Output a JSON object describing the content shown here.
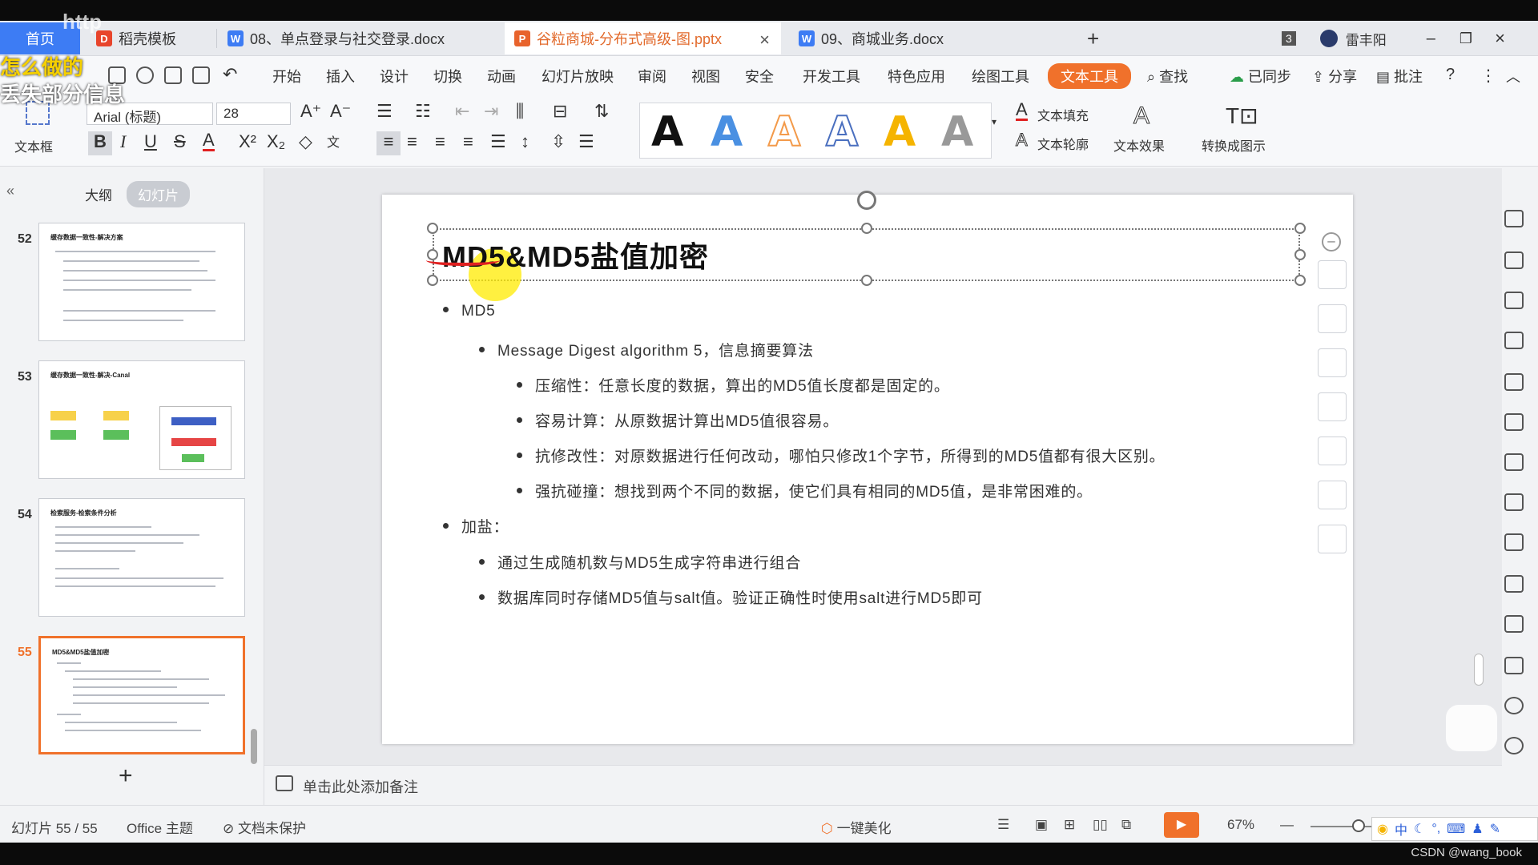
{
  "tabs": {
    "home": "首页",
    "template": "稻壳模板",
    "doc1": "08、单点登录与社交登录.docx",
    "ppt": "谷粒商城-分布式高级-图.pptx",
    "doc2": "09、商城业务.docx",
    "new_tab": "+",
    "count_badge": "3",
    "user": "雷丰阳"
  },
  "menu": {
    "items": [
      "开始",
      "插入",
      "设计",
      "切换",
      "动画",
      "幻灯片放映",
      "审阅",
      "视图",
      "安全",
      "开发工具",
      "特色应用",
      "绘图工具"
    ],
    "active": "文本工具",
    "search": "查找",
    "sync": "已同步",
    "share": "分享",
    "comment": "批注"
  },
  "toolbar": {
    "textbox": "文本框",
    "font_name": "Arial (标题)",
    "font_size": "28",
    "text_fill": "文本填充",
    "text_outline": "文本轮廓",
    "text_effect": "文本效果",
    "convert": "转换成图示",
    "style_letter": "A"
  },
  "panel": {
    "tab_outline": "大纲",
    "tab_slides": "幻灯片",
    "thumbs": [
      {
        "num": "52",
        "title": "缓存数据一致性-解决方案"
      },
      {
        "num": "53",
        "title": "缓存数据一致性-解决-Canal"
      },
      {
        "num": "54",
        "title": "检索服务-检索条件分析"
      },
      {
        "num": "55",
        "title": "MD5&MD5盐值加密"
      }
    ],
    "add": "+"
  },
  "slide": {
    "title": "MD5&MD5盐值加密",
    "b1": "MD5",
    "b1_1": "Message Digest algorithm 5，信息摘要算法",
    "b1_1_1": "压缩性：任意长度的数据，算出的MD5值长度都是固定的。",
    "b1_1_2": "容易计算：从原数据计算出MD5值很容易。",
    "b1_1_3": "抗修改性：对原数据进行任何改动，哪怕只修改1个字节，所得到的MD5值都有很大区别。",
    "b1_1_4": "强抗碰撞：想找到两个不同的数据，使它们具有相同的MD5值，是非常困难的。",
    "b2": "加盐：",
    "b2_1": "通过生成随机数与MD5生成字符串进行组合",
    "b2_2": "数据库同时存储MD5值与salt值。验证正确性时使用salt进行MD5即可"
  },
  "notes": "单击此处添加备注",
  "status": {
    "slide_count": "幻灯片 55 / 55",
    "theme": "Office 主题",
    "protect": "文档未保护",
    "beautify": "一键美化",
    "zoom": "67%"
  },
  "overlay": {
    "l1": "怎么做的",
    "l2": "丢失部分信息",
    "top": "http",
    "watermark": "CSDN @wang_book"
  },
  "colors": {
    "accent": "#f0712b",
    "home_tab": "#3d7cf4"
  }
}
